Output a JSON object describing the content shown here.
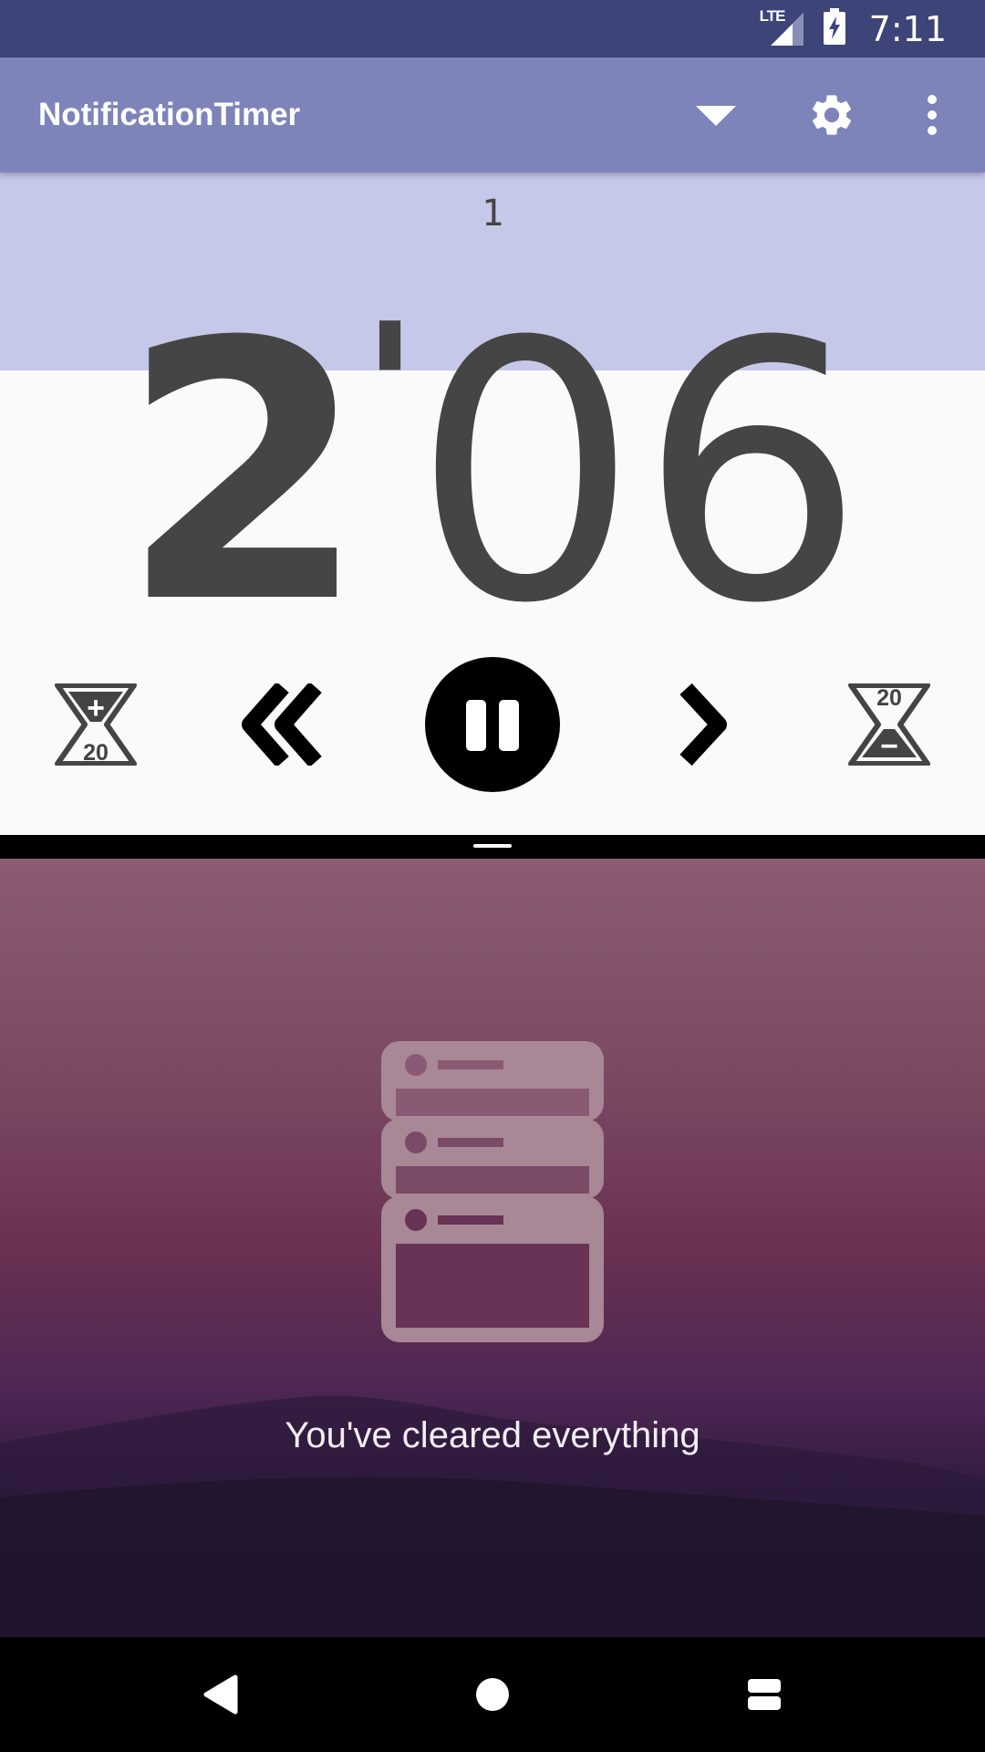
{
  "status_bar": {
    "network": "LTE",
    "time": "7:11"
  },
  "app_bar": {
    "title": "NotificationTimer",
    "icons": [
      "dropdown-icon",
      "gear-icon",
      "more-vert-icon"
    ]
  },
  "timer": {
    "lap_number": "1",
    "minutes": "2",
    "minute_mark": "'",
    "seconds": "06"
  },
  "controls": {
    "add_time_label": "20",
    "add_time_sign": "+",
    "subtract_time_label": "20",
    "subtract_time_sign": "−",
    "icons": [
      "hourglass-plus-icon",
      "double-chevron-left-icon",
      "pause-icon",
      "chevron-right-icon",
      "hourglass-minus-icon"
    ]
  },
  "notifications": {
    "empty_message": "You've cleared everything",
    "icon": "stacked-windows-icon"
  },
  "nav_bar": {
    "icons": [
      "back-icon",
      "home-icon",
      "recents-icon"
    ]
  },
  "colors": {
    "status_bar": "#3c4478",
    "app_bar": "#7c84b9",
    "timer_band": "#c5c8e9",
    "timer_text": "#454545",
    "control_dark": "#000000"
  }
}
